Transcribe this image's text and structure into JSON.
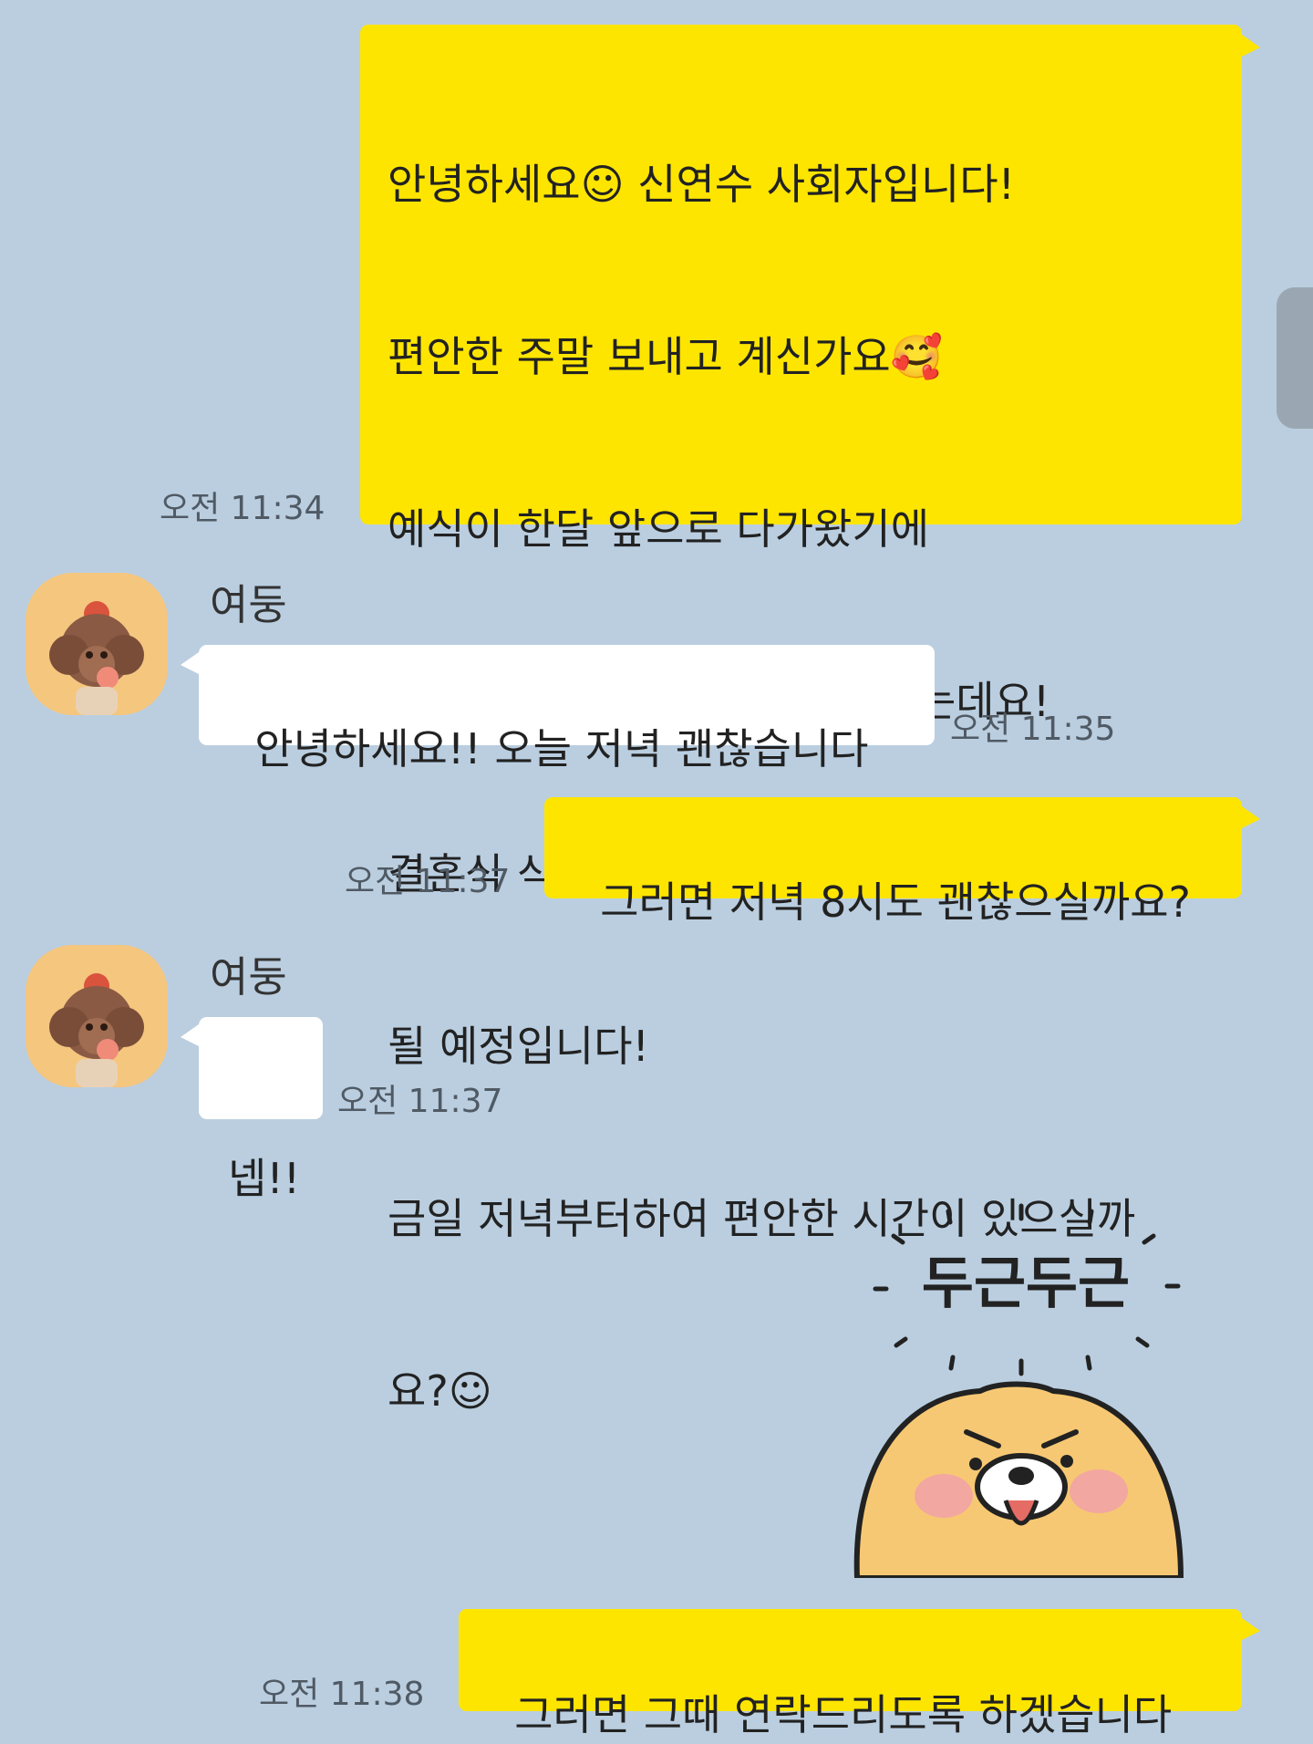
{
  "messages": [
    {
      "sender": "me",
      "lines": [
        "안녕하세요☺ 신연수 사회자입니다!",
        "편안한 주말 보내고 계신가요🥰",
        "예식이 한달 앞으로 다가왔기에",
        "1차 유선상담을 진행하고자 하는데요!",
        "결혼식 식순관련하여 약 20분 내외로 진행",
        "될 예정입니다!",
        "금일 저녁부터하여 편안한 시간이 있으실까",
        "요?☺"
      ],
      "time": "오전 11:34"
    },
    {
      "sender": "them",
      "name": "여둥",
      "text": "안녕하세요!! 오늘 저녁 괜찮습니다",
      "time": "오전 11:35"
    },
    {
      "sender": "me",
      "text": "그러면 저녁 8시도 괜찮으실까요?",
      "time": "오전 11:37"
    },
    {
      "sender": "them",
      "name": "여둥",
      "text": "넵!!",
      "time": "오전 11:37"
    },
    {
      "sender": "me",
      "type": "sticker",
      "sticker_text": "두근두근"
    },
    {
      "sender": "me",
      "text": "그러면 그때 연락드리도록 하겠습니다",
      "time": "오전 11:38"
    }
  ],
  "colors": {
    "background": "#bacee0",
    "my_bubble": "#fee500",
    "their_bubble": "#ffffff"
  }
}
